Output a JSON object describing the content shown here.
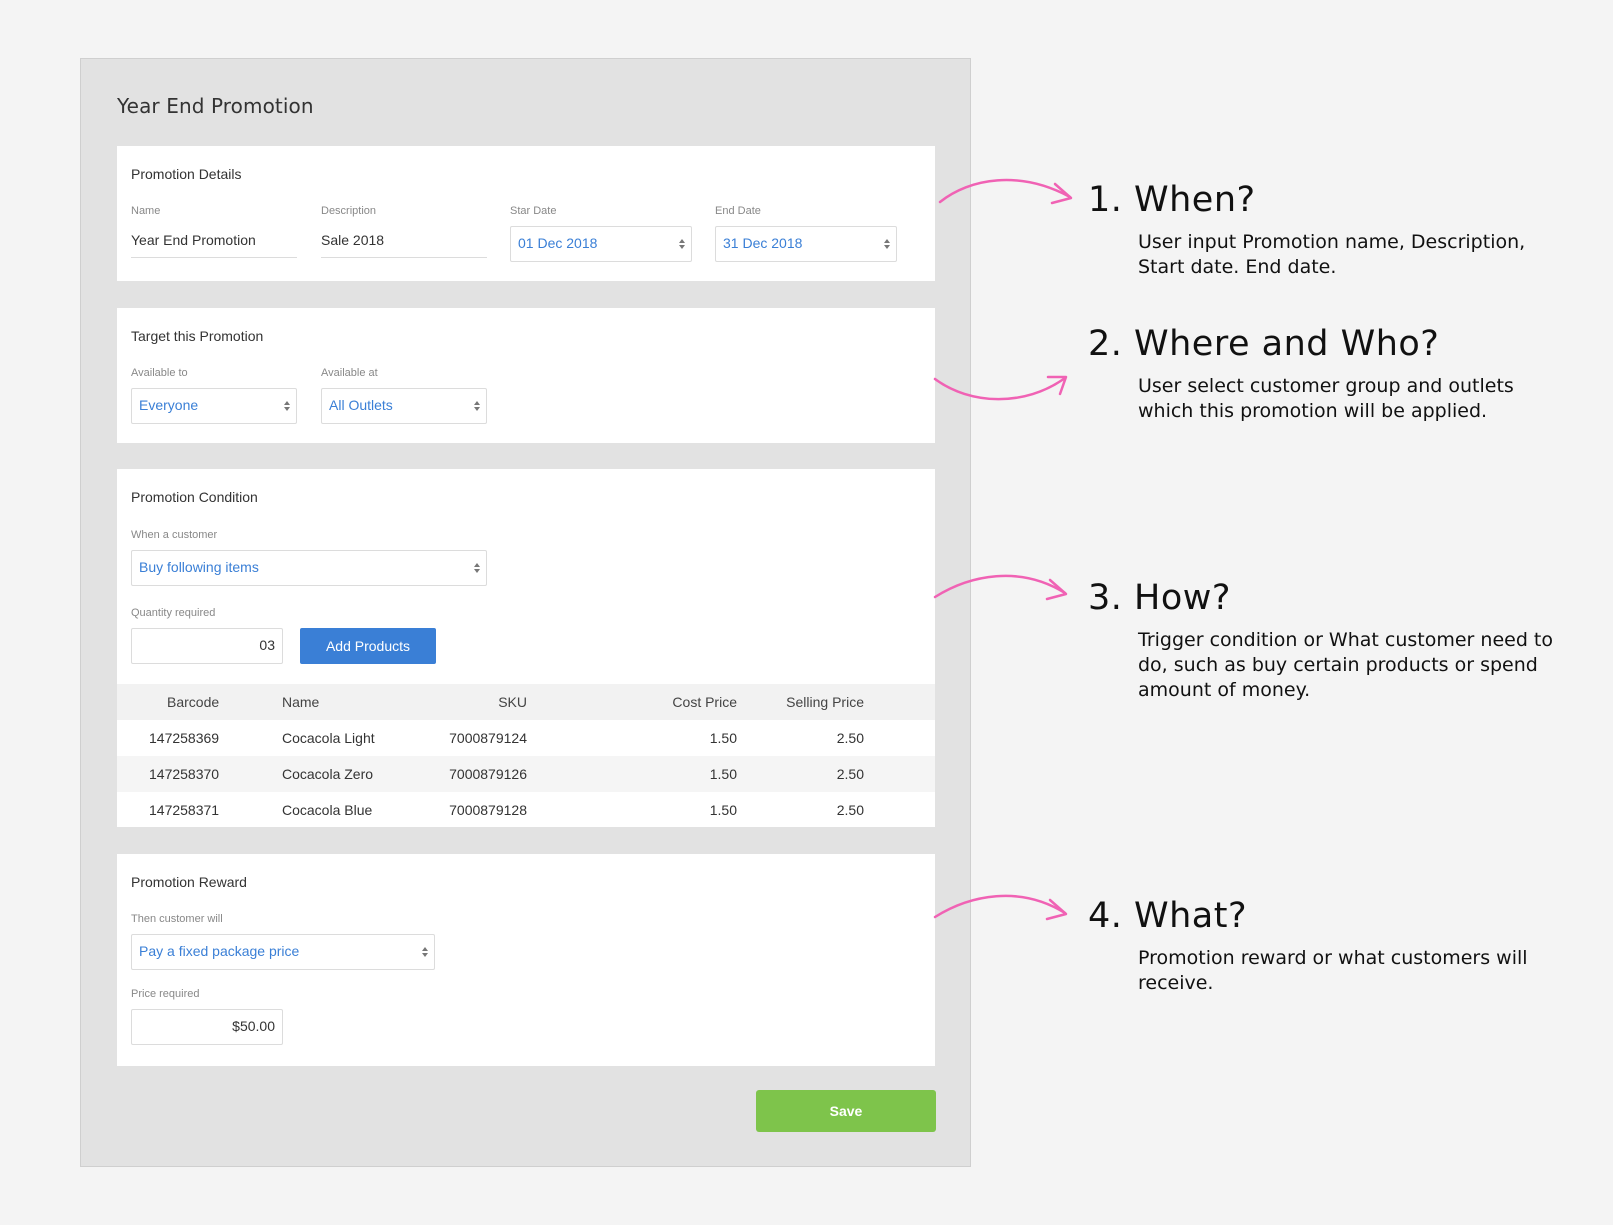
{
  "page_title": "Year End Promotion",
  "details": {
    "title": "Promotion Details",
    "name_label": "Name",
    "name_value": "Year End Promotion",
    "desc_label": "Description",
    "desc_value": "Sale 2018",
    "start_label": "Star Date",
    "start_value": "01 Dec 2018",
    "end_label": "End Date",
    "end_value": "31 Dec 2018"
  },
  "target": {
    "title": "Target this Promotion",
    "available_to_label": "Available to",
    "available_to_value": "Everyone",
    "available_at_label": "Available at",
    "available_at_value": "All Outlets"
  },
  "condition": {
    "title": "Promotion Condition",
    "when_label": "When a customer",
    "when_value": "Buy following items",
    "qty_label": "Quantity required",
    "qty_value": "03",
    "add_button": "Add Products",
    "table": {
      "headers": [
        "Barcode",
        "Name",
        "SKU",
        "Cost Price",
        "Selling Price"
      ],
      "rows": [
        [
          "147258369",
          "Cocacola Light",
          "7000879124",
          "1.50",
          "2.50"
        ],
        [
          "147258370",
          "Cocacola Zero",
          "7000879126",
          "1.50",
          "2.50"
        ],
        [
          "147258371",
          "Cocacola Blue",
          "7000879128",
          "1.50",
          "2.50"
        ]
      ]
    }
  },
  "reward": {
    "title": "Promotion Reward",
    "then_label": "Then customer will",
    "then_value": "Pay a fixed package price",
    "price_label": "Price required",
    "price_value": "$50.00"
  },
  "save_button": "Save",
  "annotations": [
    {
      "heading": "1. When?",
      "text": "User input Promotion name, Description, Start date. End date."
    },
    {
      "heading": "2. Where and Who?",
      "text": "User select customer group and outlets which this promotion will be applied."
    },
    {
      "heading": "3. How?",
      "text": "Trigger condition or What customer need to do, such as buy certain products or spend amount of money."
    },
    {
      "heading": "4. What?",
      "text": "Promotion reward or what customers will receive."
    }
  ],
  "colors": {
    "accent_blue": "#3a7fd6",
    "save_green": "#7ec44b",
    "arrow_pink": "#f062b4"
  }
}
